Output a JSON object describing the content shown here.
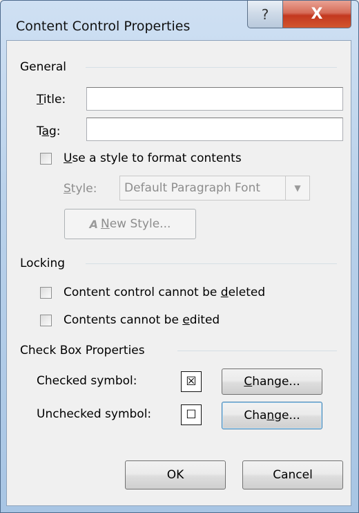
{
  "window": {
    "title": "Content Control Properties",
    "help_glyph": "?",
    "close_glyph": "X"
  },
  "general": {
    "section_label": "General",
    "title_label_u": "T",
    "title_label_rest": "itle:",
    "title_value": "",
    "tag_label_pre": "T",
    "tag_label_u": "a",
    "tag_label_rest": "g:",
    "tag_value": "",
    "use_style_u": "U",
    "use_style_rest": "se a style to format contents",
    "use_style_checked": false,
    "style_label_u": "S",
    "style_label_rest": "tyle:",
    "style_value": "Default Paragraph Font",
    "new_style_icon": "A",
    "new_style_u": "N",
    "new_style_rest": "ew Style..."
  },
  "locking": {
    "section_label": "Locking",
    "cannot_delete_pre": "Content control cannot be ",
    "cannot_delete_u": "d",
    "cannot_delete_rest": "eleted",
    "cannot_delete_checked": false,
    "cannot_edit_pre": "Contents cannot be ",
    "cannot_edit_u": "e",
    "cannot_edit_rest": "dited",
    "cannot_edit_checked": false
  },
  "checkbox_props": {
    "section_label": "Check Box Properties",
    "checked_label": "Checked symbol:",
    "checked_symbol": "☒",
    "unchecked_label": "Unchecked symbol:",
    "unchecked_symbol": "☐",
    "change1_u": "C",
    "change1_rest": "hange...",
    "change2_pre": "Cha",
    "change2_u": "n",
    "change2_rest": "ge..."
  },
  "footer": {
    "ok_label": "OK",
    "cancel_label": "Cancel"
  }
}
